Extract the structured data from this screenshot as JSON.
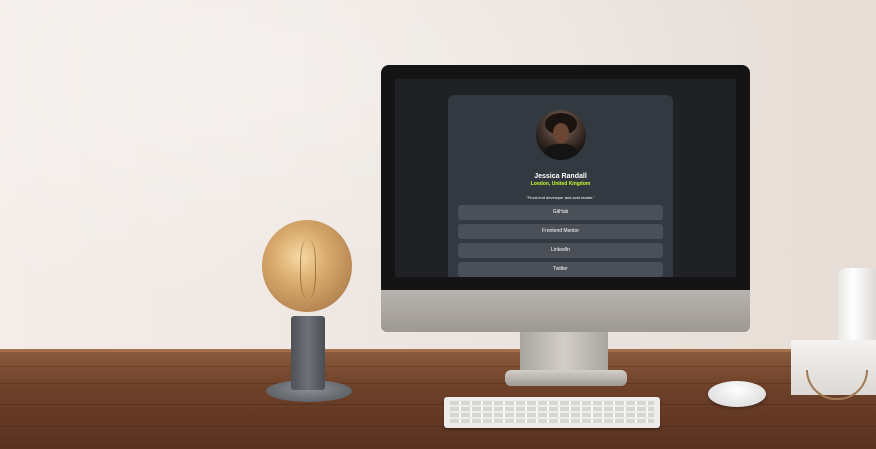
{
  "profile": {
    "name": "Jessica Randall",
    "location": "London, United Kingdom",
    "bio": "\"Front-end developer and avid reader.\"",
    "links": [
      "GitHub",
      "Frontend Mentor",
      "LinkedIn",
      "Twitter"
    ]
  },
  "colors": {
    "card_background": "#333941",
    "page_background": "#1f2124",
    "button_background": "#4b5058",
    "accent": "#c4f82a"
  }
}
